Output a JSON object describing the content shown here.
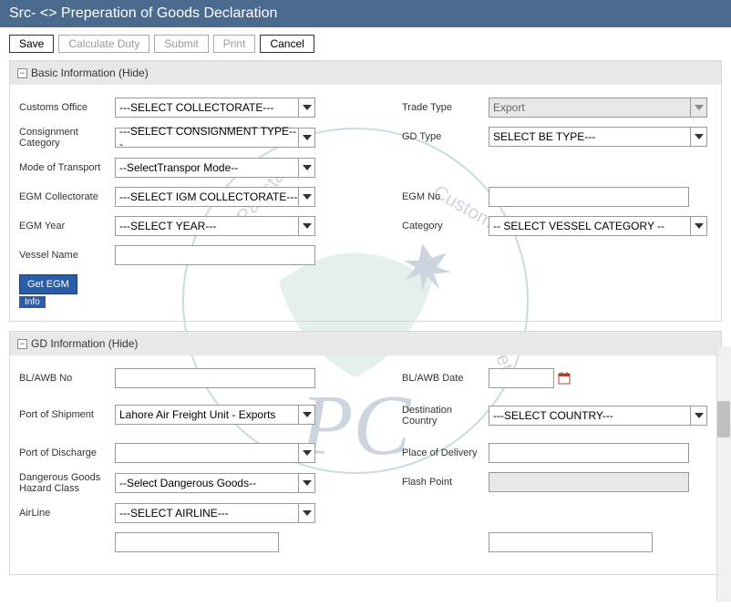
{
  "title": "Src- <> Preperation of Goods Declaration",
  "toolbar": {
    "save": "Save",
    "calc": "Calculate Duty",
    "submit": "Submit",
    "print": "Print",
    "cancel": "Cancel"
  },
  "basic": {
    "header": "Basic Information (Hide)",
    "customs_office_lbl": "Customs Office",
    "customs_office_val": "---SELECT COLLECTORATE---",
    "trade_type_lbl": "Trade Type",
    "trade_type_val": "Export",
    "consignment_lbl": "Consignment Category",
    "consignment_val": "---SELECT CONSIGNMENT TYPE---",
    "gd_type_lbl": "GD Type",
    "gd_type_val": "SELECT BE TYPE---",
    "mode_lbl": "Mode of Transport",
    "mode_val": "--SelectTranspor Mode--",
    "egm_coll_lbl": "EGM Collectorate",
    "egm_coll_val": "---SELECT IGM COLLECTORATE---",
    "egm_no_lbl": "EGM No",
    "egm_no_val": "",
    "egm_year_lbl": "EGM Year",
    "egm_year_val": "---SELECT YEAR---",
    "category_lbl": "Category",
    "category_val": "-- SELECT VESSEL CATEGORY --",
    "vessel_lbl": "Vessel Name",
    "vessel_val": "",
    "get_egm": "Get EGM",
    "info": "Info"
  },
  "gd": {
    "header": "GD Information (Hide)",
    "blawb_no_lbl": "BL/AWB No",
    "blawb_no_val": "",
    "blawb_date_lbl": "BL/AWB Date",
    "blawb_date_val": "",
    "port_ship_lbl": "Port of Shipment",
    "port_ship_val": "Lahore Air Freight Unit - Exports",
    "dest_lbl": "Destination Country",
    "dest_val": "---SELECT COUNTRY---",
    "port_dis_lbl": "Port of Discharge",
    "port_dis_val": "",
    "place_del_lbl": "Place of Delivery",
    "place_del_val": "",
    "hazard_lbl": "Dangerous Goods Hazard Class",
    "hazard_val": "--Select Dangerous Goods--",
    "flash_lbl": "Flash Point",
    "flash_val": "",
    "airline_lbl": "AirLine",
    "airline_val": "---SELECT AIRLINE---"
  }
}
